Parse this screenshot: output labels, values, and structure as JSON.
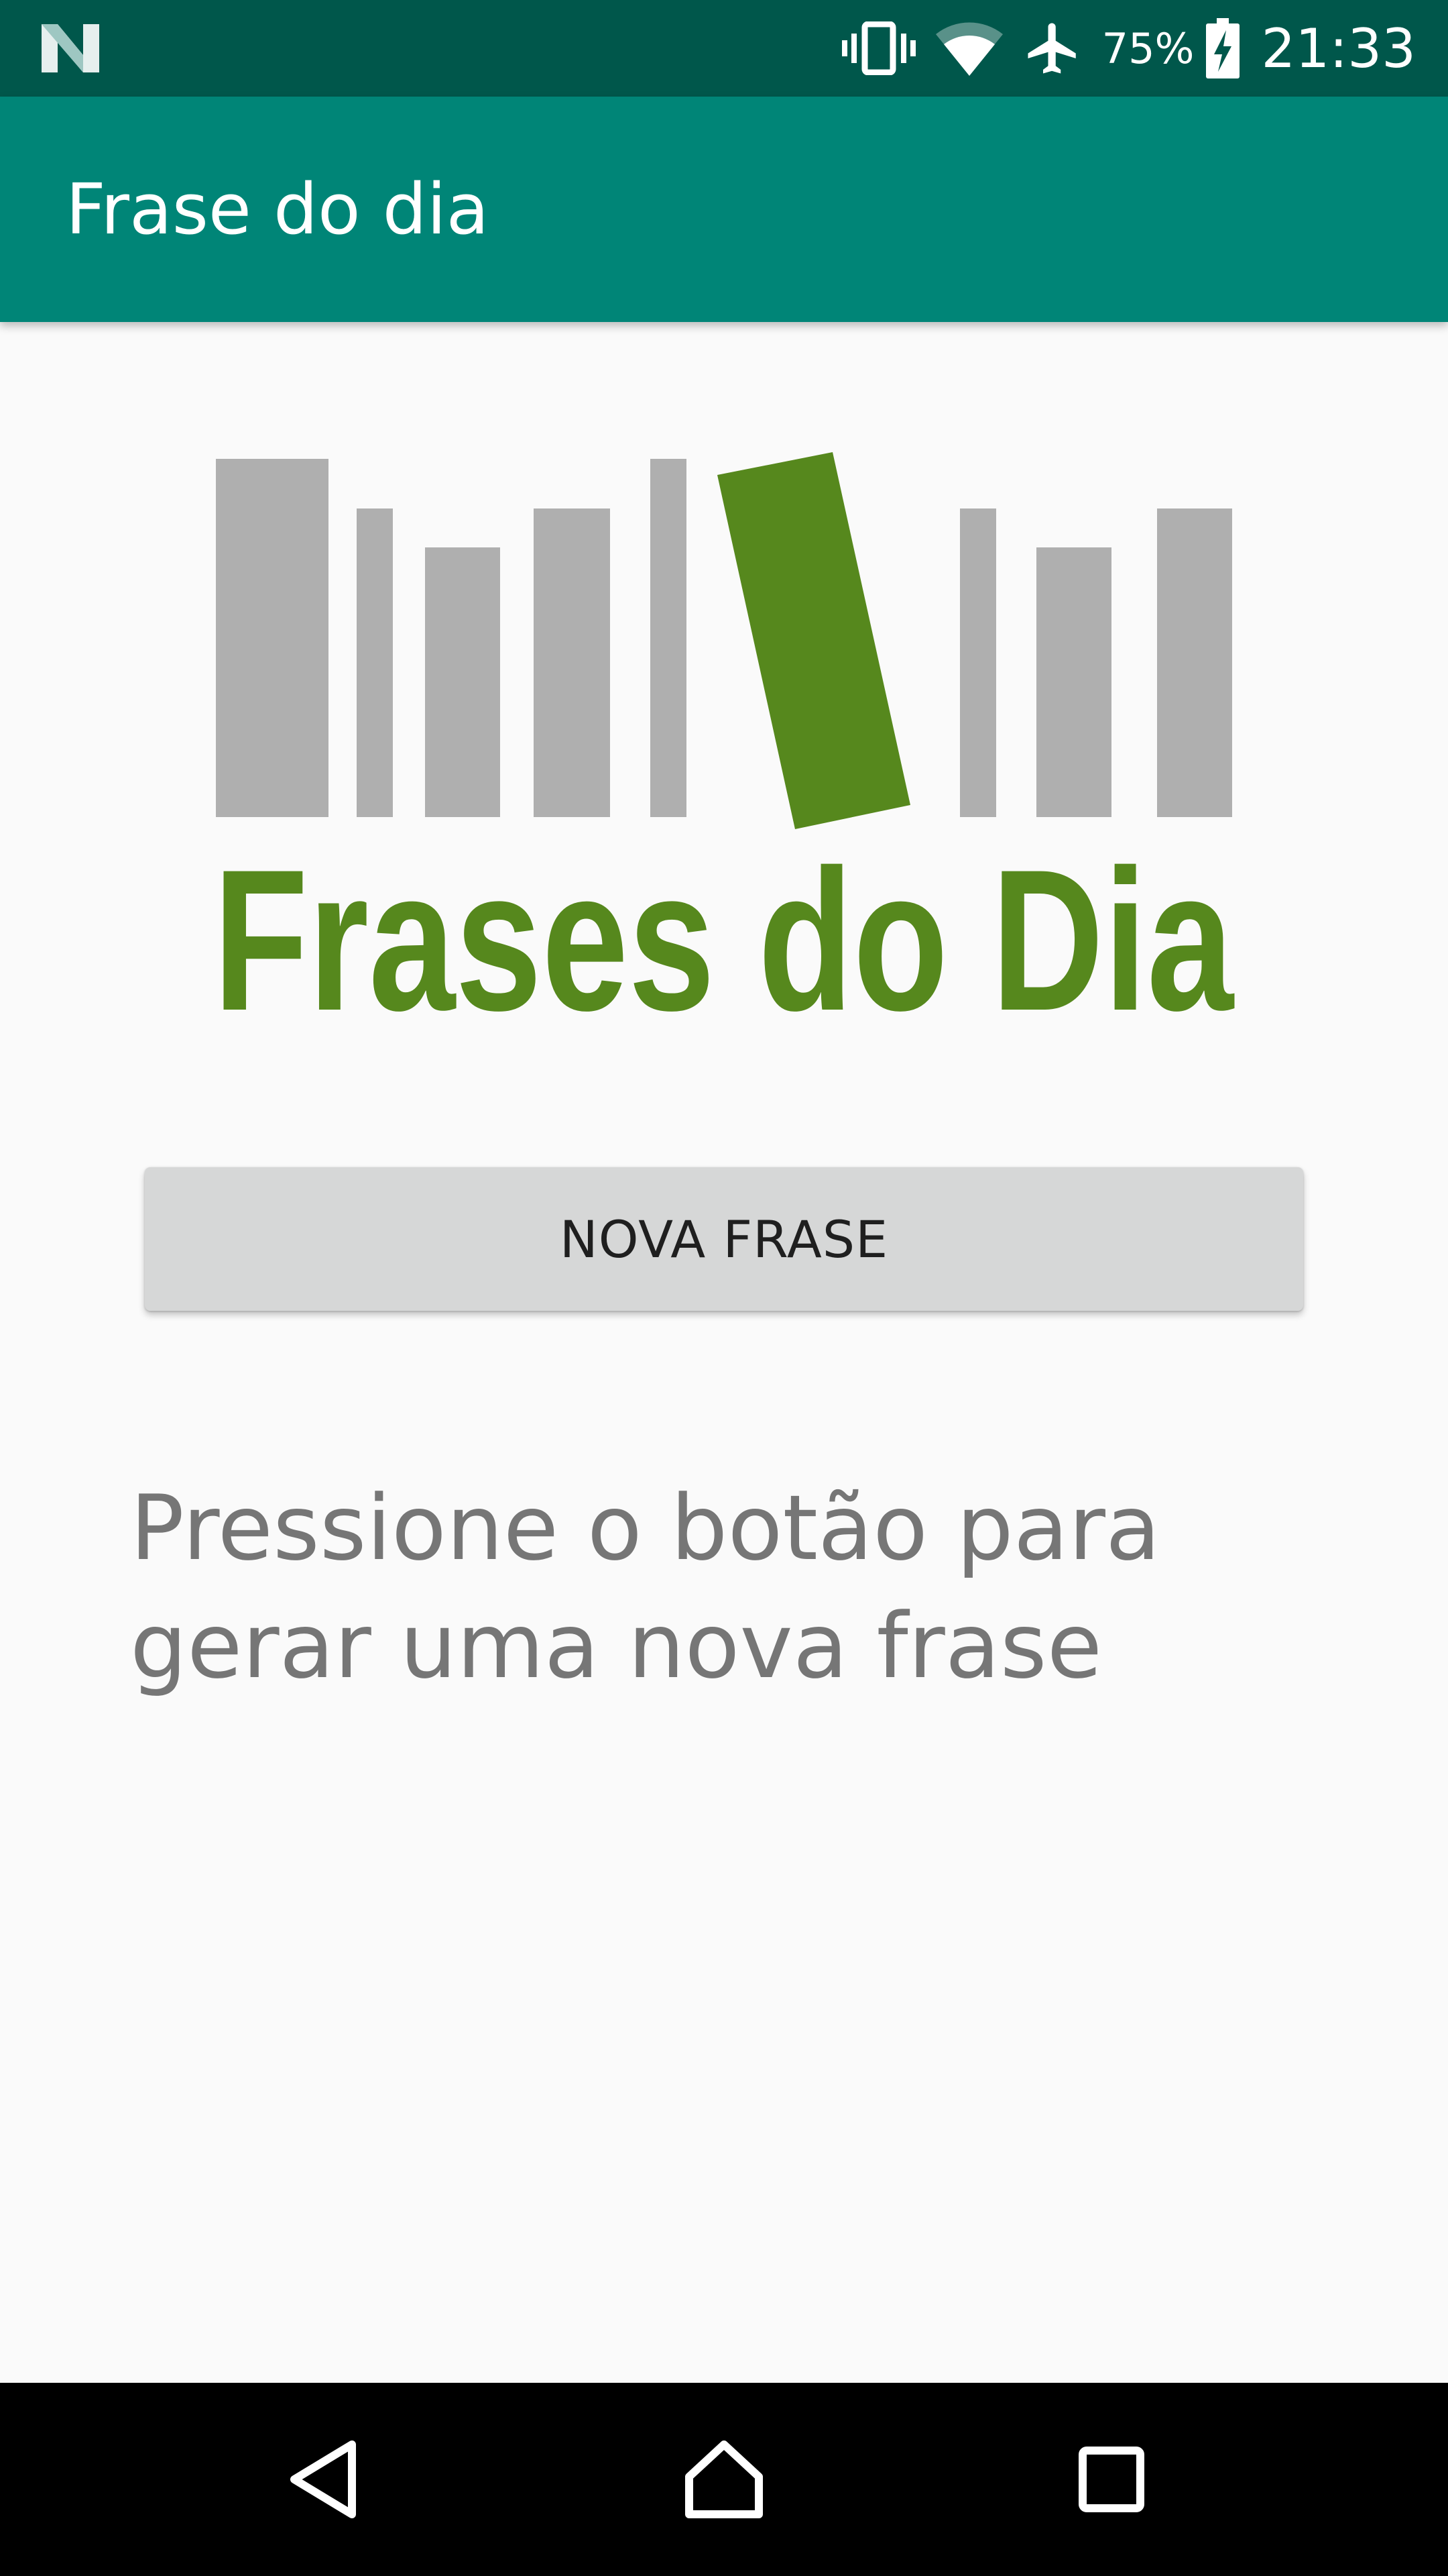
{
  "status_bar": {
    "battery_percent": "75%",
    "time": "21:33",
    "icons": [
      "notification-n-icon",
      "vibrate-icon",
      "wifi-icon",
      "airplane-mode-icon",
      "battery-charging-icon"
    ]
  },
  "app_bar": {
    "title": "Frase do dia"
  },
  "logo": {
    "text": "Frases do Dia",
    "colors": {
      "books_gray": "#afafaf",
      "brand_green": "#56881d"
    }
  },
  "main": {
    "button_label": "NOVA FRASE",
    "phrase_text": "Pressione o botão para gerar uma nova frase"
  },
  "nav_bar": {
    "icons": [
      "back-icon",
      "home-icon",
      "recents-icon"
    ]
  },
  "colors": {
    "status_bar": "#00574b",
    "app_bar": "#008577",
    "background": "#fafafa",
    "button": "#d6d7d7",
    "phrase_text": "#767676"
  }
}
